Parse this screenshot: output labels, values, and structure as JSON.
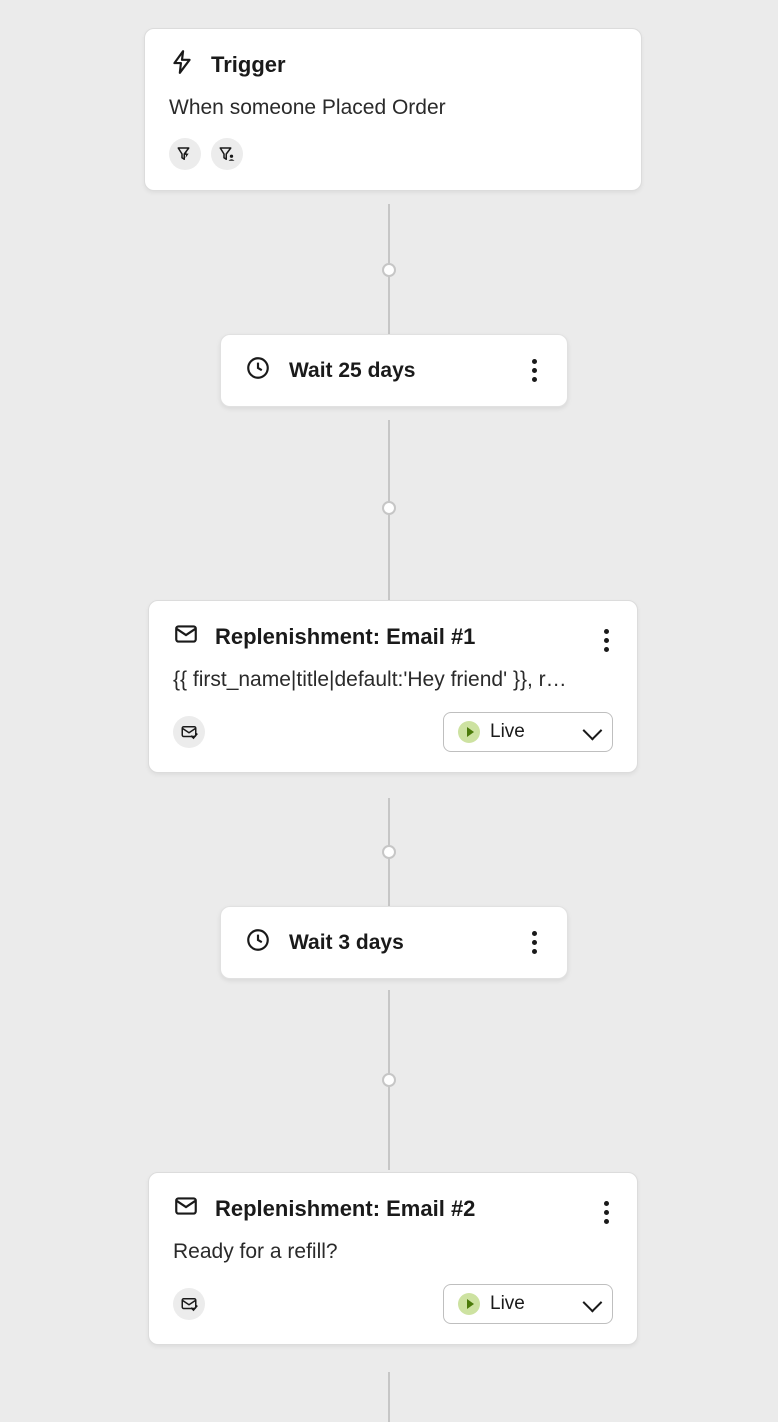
{
  "trigger": {
    "title": "Trigger",
    "description": "When someone Placed Order"
  },
  "steps": [
    {
      "type": "wait",
      "label": "Wait 25 days"
    },
    {
      "type": "email",
      "title": "Replenishment: Email #1",
      "preview": "{{ first_name|title|default:'Hey friend' }}, r…",
      "status": "Live"
    },
    {
      "type": "wait",
      "label": "Wait 3 days"
    },
    {
      "type": "email",
      "title": "Replenishment: Email #2",
      "preview": "Ready for a refill?",
      "status": "Live"
    }
  ]
}
